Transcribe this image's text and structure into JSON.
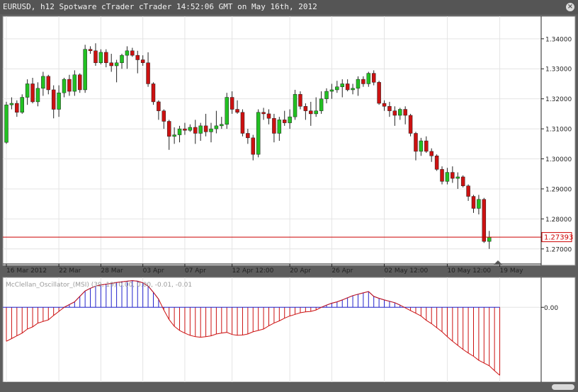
{
  "window": {
    "title": "EURUSD, h12 Spotware cTrader cTrader 14:52:06 GMT on May 16th, 2012",
    "close_icon": "close-icon"
  },
  "chart_data": [
    {
      "type": "candlestick",
      "symbol": "EURUSD",
      "timeframe": "h12",
      "ylim": [
        1.265,
        1.3475
      ],
      "grid": true,
      "y_ticks": [
        1.34,
        1.33,
        1.32,
        1.31,
        1.3,
        1.29,
        1.28,
        1.27
      ],
      "y_tick_labels": [
        "1.34000",
        "1.33000",
        "1.32000",
        "1.31000",
        "1.30000",
        "1.29000",
        "1.28000",
        "1.27000"
      ],
      "x_tick_labels": [
        {
          "label": "16 Mar 2012",
          "i": 0
        },
        {
          "label": "22 Mar",
          "i": 10
        },
        {
          "label": "28 Mar",
          "i": 18
        },
        {
          "label": "03 Apr",
          "i": 26
        },
        {
          "label": "07 Apr",
          "i": 34
        },
        {
          "label": "12 Apr 12:00",
          "i": 43
        },
        {
          "label": "20 Apr",
          "i": 54
        },
        {
          "label": "26 Apr",
          "i": 62
        },
        {
          "label": "02 May 12:00",
          "i": 72
        },
        {
          "label": "10 May 12:00",
          "i": 84
        },
        {
          "label": "19 May",
          "i": 94
        }
      ],
      "current_price": {
        "value": 1.27393,
        "label": "1.27393",
        "color": "#cc0000"
      },
      "colors": {
        "up": "#22c022",
        "down": "#cc1111",
        "wick": "#222222"
      },
      "candles": [
        {
          "o": 1.3055,
          "h": 1.319,
          "l": 1.305,
          "c": 1.318
        },
        {
          "o": 1.318,
          "h": 1.3205,
          "l": 1.3165,
          "c": 1.3185
        },
        {
          "o": 1.3185,
          "h": 1.3195,
          "l": 1.314,
          "c": 1.3155
        },
        {
          "o": 1.3155,
          "h": 1.3215,
          "l": 1.315,
          "c": 1.3205
        },
        {
          "o": 1.3205,
          "h": 1.3265,
          "l": 1.318,
          "c": 1.325
        },
        {
          "o": 1.325,
          "h": 1.327,
          "l": 1.3185,
          "c": 1.319
        },
        {
          "o": 1.319,
          "h": 1.3255,
          "l": 1.3175,
          "c": 1.3235
        },
        {
          "o": 1.3235,
          "h": 1.329,
          "l": 1.321,
          "c": 1.3275
        },
        {
          "o": 1.3275,
          "h": 1.328,
          "l": 1.3215,
          "c": 1.323
        },
        {
          "o": 1.323,
          "h": 1.3245,
          "l": 1.3135,
          "c": 1.3165
        },
        {
          "o": 1.3165,
          "h": 1.3245,
          "l": 1.314,
          "c": 1.322
        },
        {
          "o": 1.322,
          "h": 1.327,
          "l": 1.3205,
          "c": 1.3265
        },
        {
          "o": 1.3265,
          "h": 1.328,
          "l": 1.321,
          "c": 1.3225
        },
        {
          "o": 1.3225,
          "h": 1.3295,
          "l": 1.321,
          "c": 1.328
        },
        {
          "o": 1.328,
          "h": 1.3285,
          "l": 1.322,
          "c": 1.323
        },
        {
          "o": 1.323,
          "h": 1.338,
          "l": 1.322,
          "c": 1.3365
        },
        {
          "o": 1.3365,
          "h": 1.3375,
          "l": 1.335,
          "c": 1.336
        },
        {
          "o": 1.336,
          "h": 1.3385,
          "l": 1.331,
          "c": 1.332
        },
        {
          "o": 1.332,
          "h": 1.3365,
          "l": 1.3315,
          "c": 1.3355
        },
        {
          "o": 1.3355,
          "h": 1.3365,
          "l": 1.3305,
          "c": 1.332
        },
        {
          "o": 1.332,
          "h": 1.335,
          "l": 1.329,
          "c": 1.331
        },
        {
          "o": 1.331,
          "h": 1.333,
          "l": 1.3255,
          "c": 1.332
        },
        {
          "o": 1.332,
          "h": 1.335,
          "l": 1.33,
          "c": 1.3345
        },
        {
          "o": 1.3345,
          "h": 1.3375,
          "l": 1.33,
          "c": 1.336
        },
        {
          "o": 1.336,
          "h": 1.337,
          "l": 1.334,
          "c": 1.3345
        },
        {
          "o": 1.3345,
          "h": 1.336,
          "l": 1.3285,
          "c": 1.333
        },
        {
          "o": 1.333,
          "h": 1.3345,
          "l": 1.331,
          "c": 1.332
        },
        {
          "o": 1.332,
          "h": 1.3355,
          "l": 1.324,
          "c": 1.325
        },
        {
          "o": 1.325,
          "h": 1.3255,
          "l": 1.318,
          "c": 1.319
        },
        {
          "o": 1.319,
          "h": 1.3195,
          "l": 1.313,
          "c": 1.316
        },
        {
          "o": 1.316,
          "h": 1.3165,
          "l": 1.31,
          "c": 1.3125
        },
        {
          "o": 1.3125,
          "h": 1.313,
          "l": 1.303,
          "c": 1.3075
        },
        {
          "o": 1.3075,
          "h": 1.3105,
          "l": 1.305,
          "c": 1.308
        },
        {
          "o": 1.308,
          "h": 1.311,
          "l": 1.3055,
          "c": 1.31
        },
        {
          "o": 1.31,
          "h": 1.312,
          "l": 1.308,
          "c": 1.3095
        },
        {
          "o": 1.3095,
          "h": 1.3115,
          "l": 1.309,
          "c": 1.3105
        },
        {
          "o": 1.3105,
          "h": 1.313,
          "l": 1.305,
          "c": 1.3085
        },
        {
          "o": 1.3085,
          "h": 1.312,
          "l": 1.306,
          "c": 1.311
        },
        {
          "o": 1.311,
          "h": 1.315,
          "l": 1.3075,
          "c": 1.309
        },
        {
          "o": 1.309,
          "h": 1.312,
          "l": 1.3055,
          "c": 1.31
        },
        {
          "o": 1.31,
          "h": 1.316,
          "l": 1.3085,
          "c": 1.311
        },
        {
          "o": 1.311,
          "h": 1.314,
          "l": 1.31,
          "c": 1.3115
        },
        {
          "o": 1.3115,
          "h": 1.322,
          "l": 1.31,
          "c": 1.3205
        },
        {
          "o": 1.3205,
          "h": 1.3225,
          "l": 1.315,
          "c": 1.3165
        },
        {
          "o": 1.3165,
          "h": 1.3195,
          "l": 1.315,
          "c": 1.3155
        },
        {
          "o": 1.3155,
          "h": 1.3165,
          "l": 1.3075,
          "c": 1.3085
        },
        {
          "o": 1.3085,
          "h": 1.31,
          "l": 1.305,
          "c": 1.307
        },
        {
          "o": 1.307,
          "h": 1.308,
          "l": 1.2995,
          "c": 1.3015
        },
        {
          "o": 1.3015,
          "h": 1.3165,
          "l": 1.3005,
          "c": 1.3155
        },
        {
          "o": 1.3155,
          "h": 1.317,
          "l": 1.313,
          "c": 1.315
        },
        {
          "o": 1.315,
          "h": 1.3165,
          "l": 1.3115,
          "c": 1.3135
        },
        {
          "o": 1.3135,
          "h": 1.315,
          "l": 1.3055,
          "c": 1.3085
        },
        {
          "o": 1.3085,
          "h": 1.314,
          "l": 1.306,
          "c": 1.313
        },
        {
          "o": 1.313,
          "h": 1.316,
          "l": 1.311,
          "c": 1.312
        },
        {
          "o": 1.312,
          "h": 1.3165,
          "l": 1.31,
          "c": 1.314
        },
        {
          "o": 1.314,
          "h": 1.323,
          "l": 1.313,
          "c": 1.3215
        },
        {
          "o": 1.3215,
          "h": 1.3225,
          "l": 1.3165,
          "c": 1.3175
        },
        {
          "o": 1.3175,
          "h": 1.3185,
          "l": 1.313,
          "c": 1.316
        },
        {
          "o": 1.316,
          "h": 1.319,
          "l": 1.311,
          "c": 1.315
        },
        {
          "o": 1.315,
          "h": 1.3205,
          "l": 1.314,
          "c": 1.316
        },
        {
          "o": 1.316,
          "h": 1.3225,
          "l": 1.315,
          "c": 1.32
        },
        {
          "o": 1.32,
          "h": 1.3235,
          "l": 1.3185,
          "c": 1.3225
        },
        {
          "o": 1.3225,
          "h": 1.325,
          "l": 1.32,
          "c": 1.323
        },
        {
          "o": 1.323,
          "h": 1.326,
          "l": 1.322,
          "c": 1.324
        },
        {
          "o": 1.324,
          "h": 1.3265,
          "l": 1.3205,
          "c": 1.325
        },
        {
          "o": 1.325,
          "h": 1.3265,
          "l": 1.3225,
          "c": 1.323
        },
        {
          "o": 1.323,
          "h": 1.325,
          "l": 1.3215,
          "c": 1.3235
        },
        {
          "o": 1.3235,
          "h": 1.3275,
          "l": 1.321,
          "c": 1.3265
        },
        {
          "o": 1.3265,
          "h": 1.3275,
          "l": 1.324,
          "c": 1.325
        },
        {
          "o": 1.325,
          "h": 1.329,
          "l": 1.324,
          "c": 1.3285
        },
        {
          "o": 1.3285,
          "h": 1.3295,
          "l": 1.3245,
          "c": 1.3255
        },
        {
          "o": 1.3255,
          "h": 1.326,
          "l": 1.318,
          "c": 1.3185
        },
        {
          "o": 1.3185,
          "h": 1.3195,
          "l": 1.316,
          "c": 1.3175
        },
        {
          "o": 1.3175,
          "h": 1.319,
          "l": 1.314,
          "c": 1.316
        },
        {
          "o": 1.316,
          "h": 1.3175,
          "l": 1.311,
          "c": 1.3145
        },
        {
          "o": 1.3145,
          "h": 1.317,
          "l": 1.313,
          "c": 1.3165
        },
        {
          "o": 1.3165,
          "h": 1.3175,
          "l": 1.3115,
          "c": 1.3145
        },
        {
          "o": 1.3145,
          "h": 1.315,
          "l": 1.3075,
          "c": 1.3085
        },
        {
          "o": 1.3085,
          "h": 1.309,
          "l": 1.2995,
          "c": 1.3025
        },
        {
          "o": 1.3025,
          "h": 1.307,
          "l": 1.301,
          "c": 1.306
        },
        {
          "o": 1.306,
          "h": 1.3075,
          "l": 1.302,
          "c": 1.3025
        },
        {
          "o": 1.3025,
          "h": 1.3035,
          "l": 1.299,
          "c": 1.301
        },
        {
          "o": 1.301,
          "h": 1.3015,
          "l": 1.296,
          "c": 1.2965
        },
        {
          "o": 1.2965,
          "h": 1.2975,
          "l": 1.2915,
          "c": 1.2925
        },
        {
          "o": 1.2925,
          "h": 1.297,
          "l": 1.2915,
          "c": 1.2955
        },
        {
          "o": 1.2955,
          "h": 1.2975,
          "l": 1.292,
          "c": 1.2935
        },
        {
          "o": 1.2935,
          "h": 1.2955,
          "l": 1.29,
          "c": 1.294
        },
        {
          "o": 1.294,
          "h": 1.2945,
          "l": 1.2905,
          "c": 1.291
        },
        {
          "o": 1.291,
          "h": 1.2915,
          "l": 1.286,
          "c": 1.2875
        },
        {
          "o": 1.2875,
          "h": 1.288,
          "l": 1.282,
          "c": 1.2835
        },
        {
          "o": 1.2835,
          "h": 1.288,
          "l": 1.2815,
          "c": 1.2865
        },
        {
          "o": 1.2865,
          "h": 1.287,
          "l": 1.272,
          "c": 1.2725
        },
        {
          "o": 1.2725,
          "h": 1.276,
          "l": 1.27,
          "c": 1.2739
        }
      ]
    },
    {
      "type": "histogram",
      "title": "McClellan_Oscillator_(MSI) (39, 19) 0.00, 0.00, -0.01, -0.01",
      "zero_label": "0.00",
      "ylim": [
        -0.0275,
        0.011
      ],
      "colors": {
        "positive": "#2222cc",
        "negative": "#cc1111"
      },
      "values": [
        -0.0125,
        -0.0115,
        -0.0105,
        -0.0095,
        -0.008,
        -0.0072,
        -0.0058,
        -0.0052,
        -0.0046,
        -0.003,
        -0.0015,
        0.0,
        0.001,
        0.002,
        0.004,
        0.006,
        0.007,
        0.0078,
        0.0082,
        0.0085,
        0.0088,
        0.0091,
        0.0094,
        0.0096,
        0.0098,
        0.0096,
        0.009,
        0.0078,
        0.0055,
        0.003,
        -0.001,
        -0.0045,
        -0.007,
        -0.0085,
        -0.0095,
        -0.0103,
        -0.0108,
        -0.011,
        -0.0108,
        -0.0105,
        -0.0098,
        -0.0095,
        -0.0092,
        -0.01,
        -0.0103,
        -0.0102,
        -0.0098,
        -0.009,
        -0.0085,
        -0.008,
        -0.0068,
        -0.0058,
        -0.005,
        -0.004,
        -0.0032,
        -0.0026,
        -0.002,
        -0.0017,
        -0.0015,
        -0.001,
        0.0,
        0.0008,
        0.0015,
        0.002,
        0.0027,
        0.0035,
        0.0043,
        0.0048,
        0.0053,
        0.0058,
        0.004,
        0.0033,
        0.0027,
        0.0022,
        0.0017,
        0.0008,
        -0.0002,
        -0.0012,
        -0.0022,
        -0.0032,
        -0.0048,
        -0.006,
        -0.0075,
        -0.009,
        -0.0108,
        -0.0125,
        -0.014,
        -0.0155,
        -0.0168,
        -0.018,
        -0.0195,
        -0.0205,
        -0.0215,
        -0.0233,
        -0.025
      ]
    }
  ]
}
